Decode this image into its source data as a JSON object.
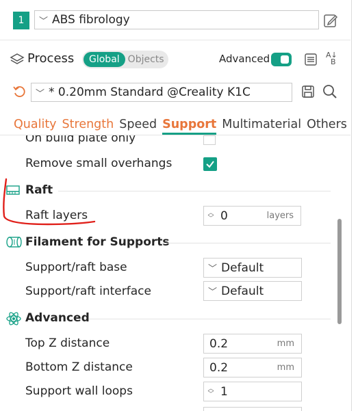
{
  "filament": {
    "index": "1",
    "name": "ABS fibrology"
  },
  "process": {
    "title": "Process",
    "global": "Global",
    "objects": "Objects",
    "advanced_label": "Advanced"
  },
  "preset": {
    "name": "* 0.20mm Standard @Creality K1C"
  },
  "tabs": [
    "Quality",
    "Strength",
    "Speed",
    "Support",
    "Multimaterial",
    "Others"
  ],
  "rows": {
    "cut_top": "On build plate only",
    "remove_overhangs": "Remove small overhangs",
    "raft_section": "Raft",
    "raft_layers": "Raft layers",
    "raft_layers_value": "0",
    "raft_layers_unit": "layers",
    "filament_section": "Filament for Supports",
    "base": "Support/raft base",
    "base_value": "Default",
    "interface": "Support/raft interface",
    "interface_value": "Default",
    "advanced_section": "Advanced",
    "top_z": "Top Z distance",
    "top_z_value": "0.2",
    "top_z_unit": "mm",
    "bottom_z": "Bottom Z distance",
    "bottom_z_value": "0.2",
    "bottom_z_unit": "mm",
    "wall_loops": "Support wall loops",
    "wall_loops_value": "1"
  },
  "colors": {
    "accent": "#15a086",
    "orange": "#e8763a",
    "annotation": "#e0201a"
  },
  "icons": [
    "edit-icon",
    "process-layers-icon",
    "list-icon",
    "compare-icon",
    "undo-icon",
    "save-icon",
    "search-icon",
    "raft-icon",
    "filament-icon",
    "atom-icon"
  ]
}
